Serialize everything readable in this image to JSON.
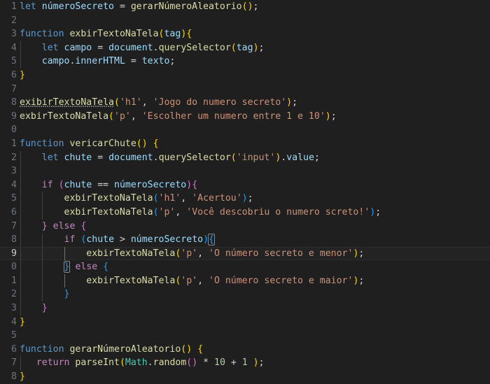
{
  "editor": {
    "name": "code-editor",
    "theme": "dark-modern",
    "background": "#1f1f1f",
    "gutter_color": "#6e7681",
    "current_line": 19,
    "first_visible_line": 1,
    "colors": {
      "keyword": "#569cd6",
      "control": "#c586c0",
      "variable": "#9cdcfe",
      "function": "#dcdcaa",
      "string": "#ce9178",
      "number": "#b5cea8",
      "class": "#4ec9b0",
      "operator": "#d4d4d4",
      "bracket1": "#ffd700",
      "bracket2": "#da70d6",
      "bracket3": "#179fff",
      "plain": "#cccccc"
    }
  },
  "lines": [
    {
      "n": 1,
      "display_n": "1",
      "text": "let númeroSecreto = gerarNúmeroAleatorio();"
    },
    {
      "n": 2,
      "display_n": "2",
      "text": ""
    },
    {
      "n": 3,
      "display_n": "3",
      "text": "function exbirTextoNaTela(tag){"
    },
    {
      "n": 4,
      "display_n": "4",
      "text": "    let campo = document.querySelector(tag);"
    },
    {
      "n": 5,
      "display_n": "5",
      "text": "    campo.innerHTML = texto;"
    },
    {
      "n": 6,
      "display_n": "6",
      "text": "}"
    },
    {
      "n": 7,
      "display_n": "7",
      "text": ""
    },
    {
      "n": 8,
      "display_n": "8",
      "text": "exibirTextoNaTela('h1', 'Jogo do numero secreto');"
    },
    {
      "n": 9,
      "display_n": "9",
      "text": "exbirTextoNaTela('p', 'Escolher um numero entre 1 e 10');"
    },
    {
      "n": 10,
      "display_n": "0",
      "text": ""
    },
    {
      "n": 11,
      "display_n": "1",
      "text": "function vericarChute() {"
    },
    {
      "n": 12,
      "display_n": "2",
      "text": "    let chute = document.querySelector('input').value;"
    },
    {
      "n": 13,
      "display_n": "3",
      "text": ""
    },
    {
      "n": 14,
      "display_n": "4",
      "text": "    if (chute == númeroSecreto){"
    },
    {
      "n": 15,
      "display_n": "5",
      "text": "        exbirTextoNaTela('h1', 'Acertou');"
    },
    {
      "n": 16,
      "display_n": "6",
      "text": "        exbirTextoNaTela('p', 'Você descobriu o numero screto!');"
    },
    {
      "n": 17,
      "display_n": "7",
      "text": "    } else {"
    },
    {
      "n": 18,
      "display_n": "8",
      "text": "        if (chute > númeroSecreto){"
    },
    {
      "n": 19,
      "display_n": "9",
      "text": "            exbirTextoNaTela('p', 'O número secreto e menor');"
    },
    {
      "n": 20,
      "display_n": "0",
      "text": "        } else {"
    },
    {
      "n": 21,
      "display_n": "1",
      "text": "            exbirTextoNaTela('p', 'O número secreto e maior');"
    },
    {
      "n": 22,
      "display_n": "2",
      "text": "        }"
    },
    {
      "n": 23,
      "display_n": "3",
      "text": "    }"
    },
    {
      "n": 24,
      "display_n": "4",
      "text": "}"
    },
    {
      "n": 25,
      "display_n": "5",
      "text": ""
    },
    {
      "n": 26,
      "display_n": "6",
      "text": "function gerarNúmeroAleatorio() {"
    },
    {
      "n": 27,
      "display_n": "7",
      "text": "   return parseInt(Math.random() * 10 + 1 );"
    },
    {
      "n": 28,
      "display_n": "8",
      "text": "}"
    }
  ],
  "tokens": {
    "l1": [
      [
        "kw",
        "let"
      ],
      [
        "op",
        " "
      ],
      [
        "var",
        "númeroSecreto"
      ],
      [
        "op",
        " = "
      ],
      [
        "fn",
        "gerarNúmeroAleatorio"
      ],
      [
        "b1",
        "("
      ],
      [
        "b1",
        ")"
      ],
      [
        "op",
        ";"
      ]
    ],
    "l3": [
      [
        "kw",
        "function"
      ],
      [
        "op",
        " "
      ],
      [
        "fn",
        "exbirTextoNaTela"
      ],
      [
        "b1",
        "("
      ],
      [
        "var",
        "tag"
      ],
      [
        "b1",
        ")"
      ],
      [
        "b1",
        "{"
      ]
    ],
    "l4": [
      [
        "op",
        "    "
      ],
      [
        "kw",
        "let"
      ],
      [
        "op",
        " "
      ],
      [
        "var",
        "campo"
      ],
      [
        "op",
        " = "
      ],
      [
        "var",
        "document"
      ],
      [
        "op",
        "."
      ],
      [
        "fn",
        "querySelector"
      ],
      [
        "b1",
        "("
      ],
      [
        "var",
        "tag"
      ],
      [
        "b1",
        ")"
      ],
      [
        "op",
        ";"
      ]
    ],
    "l5": [
      [
        "op",
        "    "
      ],
      [
        "var",
        "campo"
      ],
      [
        "op",
        "."
      ],
      [
        "var",
        "innerHTML"
      ],
      [
        "op",
        " = "
      ],
      [
        "var",
        "texto"
      ],
      [
        "op",
        ";"
      ]
    ],
    "l6": [
      [
        "b1",
        "}"
      ]
    ],
    "l8": [
      [
        "fn",
        "exibirTextoNaTela"
      ],
      [
        "b1",
        "("
      ],
      [
        "str",
        "'h1'"
      ],
      [
        "op",
        ", "
      ],
      [
        "str",
        "'Jogo do numero secreto'"
      ],
      [
        "b1",
        ")"
      ],
      [
        "op",
        ";"
      ]
    ],
    "l9": [
      [
        "fn",
        "exbirTextoNaTela"
      ],
      [
        "b1",
        "("
      ],
      [
        "str",
        "'p'"
      ],
      [
        "op",
        ", "
      ],
      [
        "str",
        "'Escolher um numero entre 1 e 10'"
      ],
      [
        "b1",
        ")"
      ],
      [
        "op",
        ";"
      ]
    ],
    "l11": [
      [
        "kw",
        "function"
      ],
      [
        "op",
        " "
      ],
      [
        "fn",
        "vericarChute"
      ],
      [
        "b1",
        "("
      ],
      [
        "b1",
        ")"
      ],
      [
        "op",
        " "
      ],
      [
        "b1",
        "{"
      ]
    ],
    "l12": [
      [
        "op",
        "    "
      ],
      [
        "kw",
        "let"
      ],
      [
        "op",
        " "
      ],
      [
        "var",
        "chute"
      ],
      [
        "op",
        " = "
      ],
      [
        "var",
        "document"
      ],
      [
        "op",
        "."
      ],
      [
        "fn",
        "querySelector"
      ],
      [
        "b1",
        "("
      ],
      [
        "str",
        "'input'"
      ],
      [
        "b1",
        ")"
      ],
      [
        "op",
        "."
      ],
      [
        "var",
        "value"
      ],
      [
        "op",
        ";"
      ]
    ],
    "l14": [
      [
        "op",
        "    "
      ],
      [
        "ctl",
        "if"
      ],
      [
        "op",
        " "
      ],
      [
        "b2",
        "("
      ],
      [
        "var",
        "chute"
      ],
      [
        "op",
        " == "
      ],
      [
        "var",
        "númeroSecreto"
      ],
      [
        "b2",
        ")"
      ],
      [
        "b2",
        "{"
      ]
    ],
    "l15": [
      [
        "op",
        "        "
      ],
      [
        "fn",
        "exbirTextoNaTela"
      ],
      [
        "b3",
        "("
      ],
      [
        "str",
        "'h1'"
      ],
      [
        "op",
        ", "
      ],
      [
        "str",
        "'Acertou'"
      ],
      [
        "b3",
        ")"
      ],
      [
        "op",
        ";"
      ]
    ],
    "l16": [
      [
        "op",
        "        "
      ],
      [
        "fn",
        "exbirTextoNaTela"
      ],
      [
        "b3",
        "("
      ],
      [
        "str",
        "'p'"
      ],
      [
        "op",
        ", "
      ],
      [
        "str",
        "'Você descobriu o numero screto!'"
      ],
      [
        "b3",
        ")"
      ],
      [
        "op",
        ";"
      ]
    ],
    "l17": [
      [
        "op",
        "    "
      ],
      [
        "b2",
        "}"
      ],
      [
        "op",
        " "
      ],
      [
        "ctl",
        "else"
      ],
      [
        "op",
        " "
      ],
      [
        "b2",
        "{"
      ]
    ],
    "l18": [
      [
        "op",
        "        "
      ],
      [
        "ctl",
        "if"
      ],
      [
        "op",
        " "
      ],
      [
        "b3",
        "("
      ],
      [
        "var",
        "chute"
      ],
      [
        "op",
        " > "
      ],
      [
        "var",
        "númeroSecreto"
      ],
      [
        "b3",
        ")"
      ],
      [
        "b3",
        "{"
      ]
    ],
    "l19": [
      [
        "op",
        "            "
      ],
      [
        "fn",
        "exbirTextoNaTela"
      ],
      [
        "b1",
        "("
      ],
      [
        "str",
        "'p'"
      ],
      [
        "op",
        ", "
      ],
      [
        "str",
        "'O número secreto e menor'"
      ],
      [
        "b1",
        ")"
      ],
      [
        "op",
        ";"
      ]
    ],
    "l20": [
      [
        "op",
        "        "
      ],
      [
        "b3",
        "}"
      ],
      [
        "op",
        " "
      ],
      [
        "ctl",
        "else"
      ],
      [
        "op",
        " "
      ],
      [
        "b3",
        "{"
      ]
    ],
    "l21": [
      [
        "op",
        "            "
      ],
      [
        "fn",
        "exbirTextoNaTela"
      ],
      [
        "b1",
        "("
      ],
      [
        "str",
        "'p'"
      ],
      [
        "op",
        ", "
      ],
      [
        "str",
        "'O número secreto e maior'"
      ],
      [
        "b1",
        ")"
      ],
      [
        "op",
        ";"
      ]
    ],
    "l22": [
      [
        "op",
        "        "
      ],
      [
        "b3",
        "}"
      ]
    ],
    "l23": [
      [
        "op",
        "    "
      ],
      [
        "b2",
        "}"
      ]
    ],
    "l24": [
      [
        "b1",
        "}"
      ]
    ],
    "l26": [
      [
        "kw",
        "function"
      ],
      [
        "op",
        " "
      ],
      [
        "fn",
        "gerarNúmeroAleatorio"
      ],
      [
        "b1",
        "("
      ],
      [
        "b1",
        ")"
      ],
      [
        "op",
        " "
      ],
      [
        "b1",
        "{"
      ]
    ],
    "l27": [
      [
        "op",
        "   "
      ],
      [
        "ctl",
        "return"
      ],
      [
        "op",
        " "
      ],
      [
        "fn",
        "parseInt"
      ],
      [
        "b1",
        "("
      ],
      [
        "cls",
        "Math"
      ],
      [
        "op",
        "."
      ],
      [
        "fn",
        "random"
      ],
      [
        "b2",
        "("
      ],
      [
        "b2",
        ")"
      ],
      [
        "op",
        " * "
      ],
      [
        "num",
        "10"
      ],
      [
        "op",
        " + "
      ],
      [
        "num",
        "1"
      ],
      [
        "op",
        " "
      ],
      [
        "b1",
        ")"
      ],
      [
        "op",
        ";"
      ]
    ],
    "l28": [
      [
        "b1",
        "}"
      ]
    ]
  },
  "diagnostics": [
    {
      "line": 8,
      "token": "exibirTextoNaTela",
      "style": "dotted-underline"
    }
  ],
  "bracket_matches": [
    {
      "line": 18,
      "char": "{"
    },
    {
      "line": 20,
      "char": "}"
    }
  ]
}
